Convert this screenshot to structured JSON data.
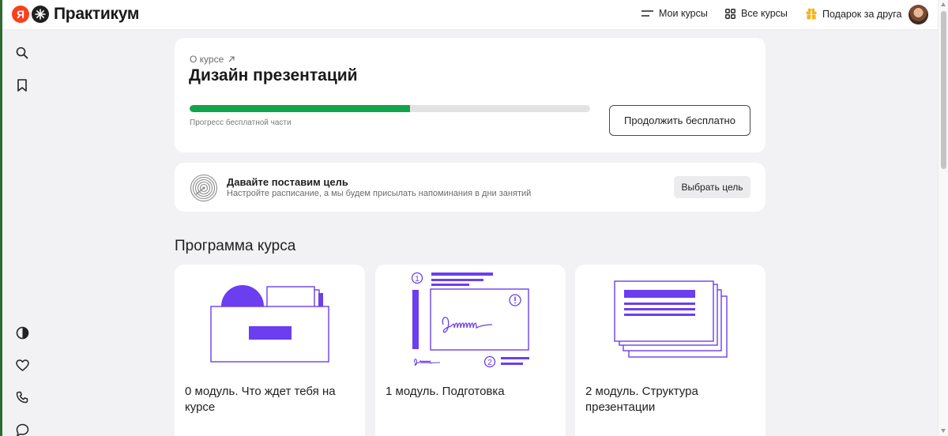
{
  "header": {
    "logo_ya": "Я",
    "logo_text": "Практикум",
    "nav": [
      {
        "label": "Мои курсы",
        "icon": "menu-lines-icon"
      },
      {
        "label": "Все курсы",
        "icon": "grid-icon"
      },
      {
        "label": "Подарок за друга",
        "icon": "gift-icon"
      }
    ]
  },
  "sidebar": {
    "top_icons": [
      "search-icon",
      "bookmark-icon"
    ],
    "bottom_icons": [
      "theme-contrast-icon",
      "heart-icon",
      "phone-icon",
      "chat-icon"
    ]
  },
  "course": {
    "about_link": "О курсе",
    "title": "Дизайн презентаций",
    "progress_fraction": 0.55,
    "progress_label": "Прогресс бесплатной части",
    "continue_button": "Продолжить бесплатно"
  },
  "goal": {
    "title": "Давайте поставим цель",
    "subtitle": "Настройте расписание, а мы будем присылать напоминания в дни занятий",
    "button": "Выбрать цель"
  },
  "program": {
    "title": "Программа курса",
    "modules": [
      {
        "title": "0 модуль. Что ждет тебя на курсе"
      },
      {
        "title": "1 модуль. Подготовка"
      },
      {
        "title": "2 модуль. Структура презентации"
      }
    ],
    "illustration_numbers": [
      "1",
      "2"
    ]
  },
  "colors": {
    "accent_purple": "#6b3ef0",
    "progress_green": "#12a44a",
    "brand_red": "#fc3f1d",
    "gift_yellow": "#f5b21b"
  }
}
